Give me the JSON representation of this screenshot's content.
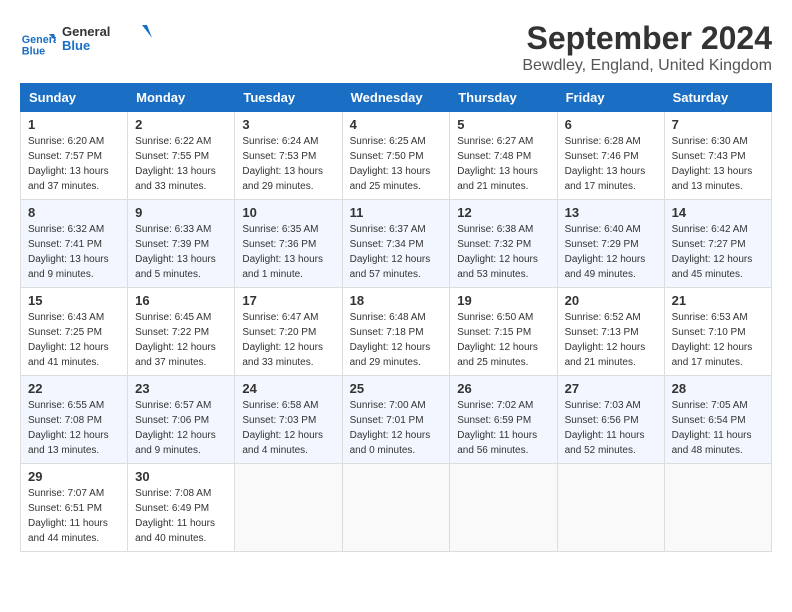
{
  "app": {
    "name_line1": "General",
    "name_line2": "Blue"
  },
  "title": "September 2024",
  "subtitle": "Bewdley, England, United Kingdom",
  "columns": [
    "Sunday",
    "Monday",
    "Tuesday",
    "Wednesday",
    "Thursday",
    "Friday",
    "Saturday"
  ],
  "weeks": [
    [
      {
        "day": "1",
        "sunrise": "6:20 AM",
        "sunset": "7:57 PM",
        "daylight": "13 hours and 37 minutes."
      },
      {
        "day": "2",
        "sunrise": "6:22 AM",
        "sunset": "7:55 PM",
        "daylight": "13 hours and 33 minutes."
      },
      {
        "day": "3",
        "sunrise": "6:24 AM",
        "sunset": "7:53 PM",
        "daylight": "13 hours and 29 minutes."
      },
      {
        "day": "4",
        "sunrise": "6:25 AM",
        "sunset": "7:50 PM",
        "daylight": "13 hours and 25 minutes."
      },
      {
        "day": "5",
        "sunrise": "6:27 AM",
        "sunset": "7:48 PM",
        "daylight": "13 hours and 21 minutes."
      },
      {
        "day": "6",
        "sunrise": "6:28 AM",
        "sunset": "7:46 PM",
        "daylight": "13 hours and 17 minutes."
      },
      {
        "day": "7",
        "sunrise": "6:30 AM",
        "sunset": "7:43 PM",
        "daylight": "13 hours and 13 minutes."
      }
    ],
    [
      {
        "day": "8",
        "sunrise": "6:32 AM",
        "sunset": "7:41 PM",
        "daylight": "13 hours and 9 minutes."
      },
      {
        "day": "9",
        "sunrise": "6:33 AM",
        "sunset": "7:39 PM",
        "daylight": "13 hours and 5 minutes."
      },
      {
        "day": "10",
        "sunrise": "6:35 AM",
        "sunset": "7:36 PM",
        "daylight": "13 hours and 1 minute."
      },
      {
        "day": "11",
        "sunrise": "6:37 AM",
        "sunset": "7:34 PM",
        "daylight": "12 hours and 57 minutes."
      },
      {
        "day": "12",
        "sunrise": "6:38 AM",
        "sunset": "7:32 PM",
        "daylight": "12 hours and 53 minutes."
      },
      {
        "day": "13",
        "sunrise": "6:40 AM",
        "sunset": "7:29 PM",
        "daylight": "12 hours and 49 minutes."
      },
      {
        "day": "14",
        "sunrise": "6:42 AM",
        "sunset": "7:27 PM",
        "daylight": "12 hours and 45 minutes."
      }
    ],
    [
      {
        "day": "15",
        "sunrise": "6:43 AM",
        "sunset": "7:25 PM",
        "daylight": "12 hours and 41 minutes."
      },
      {
        "day": "16",
        "sunrise": "6:45 AM",
        "sunset": "7:22 PM",
        "daylight": "12 hours and 37 minutes."
      },
      {
        "day": "17",
        "sunrise": "6:47 AM",
        "sunset": "7:20 PM",
        "daylight": "12 hours and 33 minutes."
      },
      {
        "day": "18",
        "sunrise": "6:48 AM",
        "sunset": "7:18 PM",
        "daylight": "12 hours and 29 minutes."
      },
      {
        "day": "19",
        "sunrise": "6:50 AM",
        "sunset": "7:15 PM",
        "daylight": "12 hours and 25 minutes."
      },
      {
        "day": "20",
        "sunrise": "6:52 AM",
        "sunset": "7:13 PM",
        "daylight": "12 hours and 21 minutes."
      },
      {
        "day": "21",
        "sunrise": "6:53 AM",
        "sunset": "7:10 PM",
        "daylight": "12 hours and 17 minutes."
      }
    ],
    [
      {
        "day": "22",
        "sunrise": "6:55 AM",
        "sunset": "7:08 PM",
        "daylight": "12 hours and 13 minutes."
      },
      {
        "day": "23",
        "sunrise": "6:57 AM",
        "sunset": "7:06 PM",
        "daylight": "12 hours and 9 minutes."
      },
      {
        "day": "24",
        "sunrise": "6:58 AM",
        "sunset": "7:03 PM",
        "daylight": "12 hours and 4 minutes."
      },
      {
        "day": "25",
        "sunrise": "7:00 AM",
        "sunset": "7:01 PM",
        "daylight": "12 hours and 0 minutes."
      },
      {
        "day": "26",
        "sunrise": "7:02 AM",
        "sunset": "6:59 PM",
        "daylight": "11 hours and 56 minutes."
      },
      {
        "day": "27",
        "sunrise": "7:03 AM",
        "sunset": "6:56 PM",
        "daylight": "11 hours and 52 minutes."
      },
      {
        "day": "28",
        "sunrise": "7:05 AM",
        "sunset": "6:54 PM",
        "daylight": "11 hours and 48 minutes."
      }
    ],
    [
      {
        "day": "29",
        "sunrise": "7:07 AM",
        "sunset": "6:51 PM",
        "daylight": "11 hours and 44 minutes."
      },
      {
        "day": "30",
        "sunrise": "7:08 AM",
        "sunset": "6:49 PM",
        "daylight": "11 hours and 40 minutes."
      },
      null,
      null,
      null,
      null,
      null
    ]
  ]
}
